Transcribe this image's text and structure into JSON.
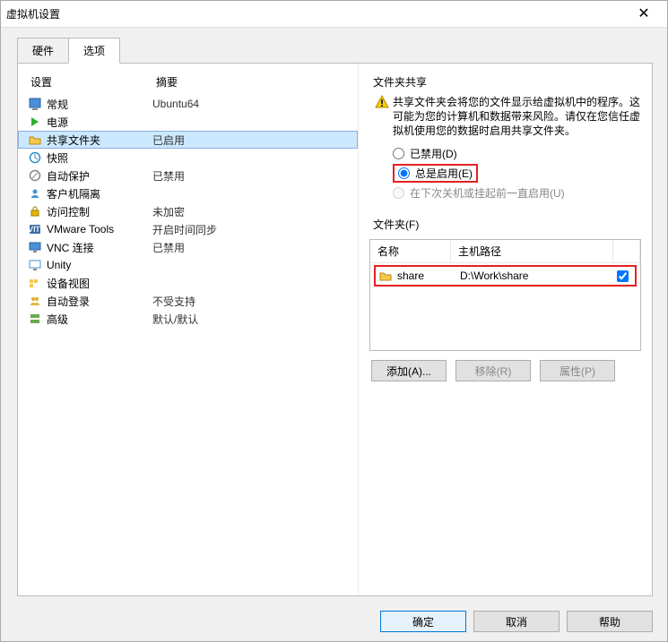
{
  "window": {
    "title": "虚拟机设置"
  },
  "tabs": {
    "hardware": "硬件",
    "options": "选项"
  },
  "list": {
    "header_setting": "设置",
    "header_summary": "摘要",
    "rows": [
      {
        "name": "常规",
        "summary": "Ubuntu64"
      },
      {
        "name": "电源",
        "summary": ""
      },
      {
        "name": "共享文件夹",
        "summary": "已启用"
      },
      {
        "name": "快照",
        "summary": ""
      },
      {
        "name": "自动保护",
        "summary": "已禁用"
      },
      {
        "name": "客户机隔离",
        "summary": ""
      },
      {
        "name": "访问控制",
        "summary": "未加密"
      },
      {
        "name": "VMware Tools",
        "summary": "开启时间同步"
      },
      {
        "name": "VNC 连接",
        "summary": "已禁用"
      },
      {
        "name": "Unity",
        "summary": ""
      },
      {
        "name": "设备视图",
        "summary": ""
      },
      {
        "name": "自动登录",
        "summary": "不受支持"
      },
      {
        "name": "高级",
        "summary": "默认/默认"
      }
    ]
  },
  "sharing": {
    "group_label": "文件夹共享",
    "warning_text": "共享文件夹会将您的文件显示给虚拟机中的程序。这可能为您的计算机和数据带来风险。请仅在您信任虚拟机使用您的数据时启用共享文件夹。",
    "radio_disabled": "已禁用(D)",
    "radio_always": "总是启用(E)",
    "radio_until_next": "在下次关机或挂起前一直启用(U)"
  },
  "folders": {
    "group_label": "文件夹(F)",
    "header_name": "名称",
    "header_path": "主机路径",
    "rows": [
      {
        "name": "share",
        "path": "D:\\Work\\share",
        "enabled": true
      }
    ],
    "btn_add": "添加(A)...",
    "btn_remove": "移除(R)",
    "btn_props": "属性(P)"
  },
  "footer": {
    "ok": "确定",
    "cancel": "取消",
    "help": "帮助"
  },
  "colors": {
    "highlight_red": "#e62020",
    "selection_blue": "#cce8ff",
    "primary_border": "#0078d7"
  }
}
